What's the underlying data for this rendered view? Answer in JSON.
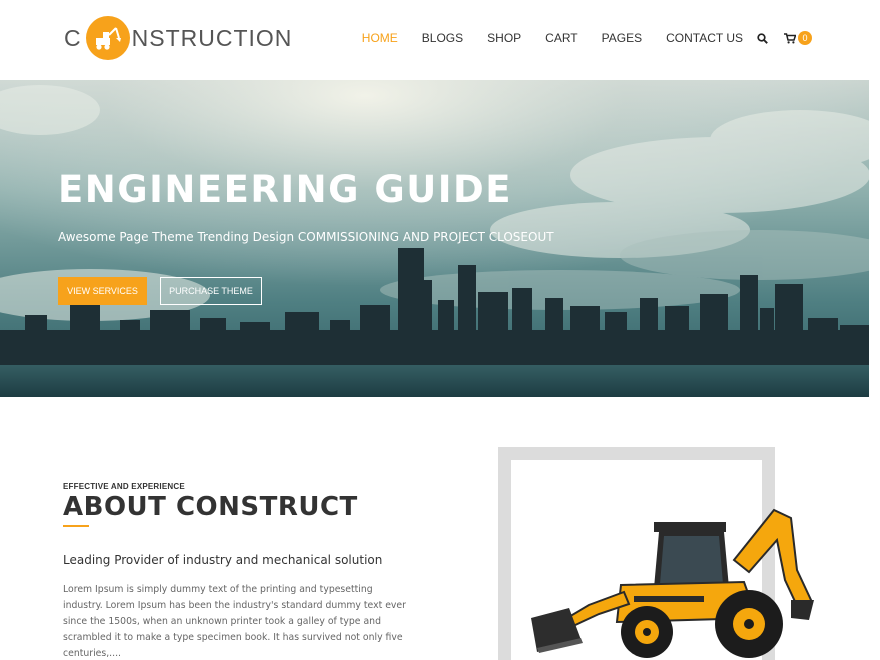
{
  "brand": {
    "logo_prefix": "C",
    "logo_middle": "NSTRUCT",
    "logo_suffix": "ION",
    "accent_color": "#f7a21b"
  },
  "nav": {
    "items": [
      {
        "label": "HOME",
        "active": true
      },
      {
        "label": "BLOGS",
        "active": false
      },
      {
        "label": "SHOP",
        "active": false
      },
      {
        "label": "CART",
        "active": false
      },
      {
        "label": "PAGES",
        "active": false
      },
      {
        "label": "CONTACT US",
        "active": false
      }
    ],
    "search_icon": "search-icon",
    "cart_icon": "cart-icon",
    "cart_count": "0"
  },
  "hero": {
    "title": "ENGINEERING GUIDE",
    "subtitle": "Awesome Page Theme Trending Design COMMISSIONING AND PROJECT CLOSEOUT",
    "primary_button": "VIEW SERVICES",
    "secondary_button": "PURCHASE THEME"
  },
  "about": {
    "eyebrow": "EFFECTIVE AND EXPERIENCE",
    "title": "ABOUT CONSTRUCT",
    "lead": "Leading Provider of industry and mechanical solution",
    "body": "Lorem Ipsum is simply dummy text of the printing and typesetting industry. Lorem Ipsum has been the industry's standard dummy text ever since the 1500s, when an unknown printer took a galley of type and scrambled it to make a type specimen book. It has survived not only five centuries,...."
  }
}
